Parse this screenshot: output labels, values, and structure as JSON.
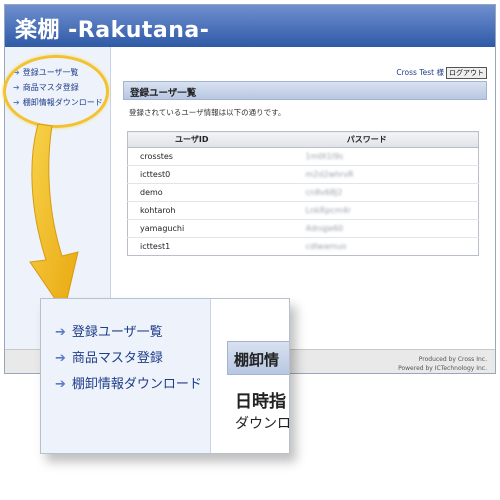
{
  "app": {
    "title": "楽棚 -Rakutana-"
  },
  "sidebar": {
    "items": [
      {
        "label": "登録ユーザ一覧"
      },
      {
        "label": "商品マスタ登録"
      },
      {
        "label": "棚卸情報ダウンロード"
      }
    ]
  },
  "user": {
    "name": "Cross Test 様",
    "logout_label": "ログアウト"
  },
  "main": {
    "section_title": "登録ユーザ一覧",
    "intro": "登録されているユーザ情報は以下の通りです。",
    "table": {
      "headers": [
        "ユーザID",
        "パスワード"
      ],
      "rows": [
        {
          "id": "crosstes",
          "password": "1m0t1l9s"
        },
        {
          "id": "icttest0",
          "password": "m2d2whrvR"
        },
        {
          "id": "demo",
          "password": "cn8v68J2"
        },
        {
          "id": "kohtaroh",
          "password": "LnkRpcm4r"
        },
        {
          "id": "yamaguchi",
          "password": "4dnqje60"
        },
        {
          "id": "icttest1",
          "password": "cdlwamuo"
        }
      ]
    }
  },
  "footer": {
    "line1": "Produced by Cross Inc.",
    "line2": "Powered by ICTechnology Inc."
  },
  "zoom": {
    "items": [
      {
        "label": "登録ユーザ一覧"
      },
      {
        "label": "商品マスタ登録"
      },
      {
        "label": "棚卸情報ダウンロード"
      }
    ],
    "section_title": "棚卸情",
    "heading": "日時指",
    "text": "ダウンロ"
  },
  "colors": {
    "header_top": "#6f8fcf",
    "header_bottom": "#2f5aa7",
    "link": "#1f3d8a",
    "highlight": "#f2c230"
  },
  "icons": {
    "nav_arrow": "arrow-right-icon",
    "callout_arrow": "yellow-down-arrow-icon"
  }
}
